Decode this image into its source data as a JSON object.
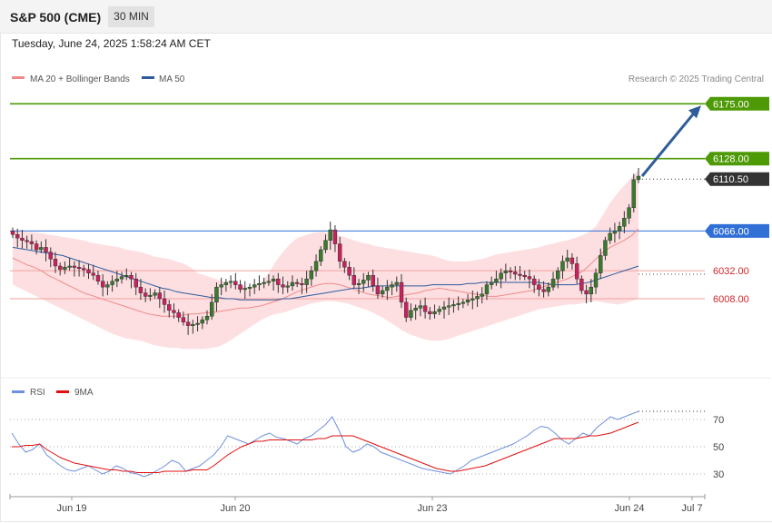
{
  "header": {
    "symbol_title": "S&P 500 (CME)",
    "timeframe_button": "30 MIN",
    "timestamp": "Tuesday, June 24, 2025 1:58:24 AM CET",
    "credit": "Research © 2025 Trading Central"
  },
  "colors": {
    "up_candle": "#3a7a2e",
    "down_candle": "#c7225f",
    "ma20": "#f08b8b",
    "ma50": "#2e5b9c",
    "band_fill": "#fdd7d9",
    "resistance": "#4e9a06",
    "support": "#f2a0a0",
    "current_price": "#333333",
    "pivot": "#2f6fd6",
    "rsi": "#6e90e0",
    "rsi_ma": "#e01010",
    "arrow": "#2f5d9a"
  },
  "chart_data": [
    {
      "type": "candlestick",
      "legend": [
        {
          "name": "MA 20 + Bollinger Bands",
          "color": "#f08b8b"
        },
        {
          "name": "MA 50",
          "color": "#2e5b9c"
        }
      ],
      "x_ticks": [
        "Jun 19",
        "Jun 20",
        "Jun 23",
        "Jun 24",
        "Jul 7"
      ],
      "ylim": [
        5945,
        6190
      ],
      "levels": [
        {
          "label": "6175.00",
          "value": 6175.0,
          "kind": "resistance"
        },
        {
          "label": "6128.00",
          "value": 6128.0,
          "kind": "resistance"
        },
        {
          "label": "6110.50",
          "value": 6110.5,
          "kind": "current"
        },
        {
          "label": "6066.00",
          "value": 6066.0,
          "kind": "pivot"
        },
        {
          "label": "6032.00",
          "value": 6032.0,
          "kind": "support"
        },
        {
          "label": "6008.00",
          "value": 6008.0,
          "kind": "support"
        }
      ],
      "close": [
        6063,
        6060,
        6058,
        6057,
        6055,
        6050,
        6052,
        6048,
        6042,
        6036,
        6033,
        6035,
        6036,
        6035,
        6034,
        6033,
        6030,
        6028,
        6023,
        6018,
        6020,
        6023,
        6025,
        6027,
        6028,
        6025,
        6018,
        6013,
        6010,
        6011,
        6013,
        6008,
        6003,
        5998,
        5996,
        5992,
        5988,
        5985,
        5986,
        5987,
        5990,
        5993,
        6005,
        6018,
        6020,
        6022,
        6023,
        6020,
        6016,
        6017,
        6018,
        6020,
        6021,
        6022,
        6023,
        6025,
        6020,
        6018,
        6019,
        6022,
        6021,
        6020,
        6025,
        6032,
        6040,
        6050,
        6058,
        6067,
        6055,
        6040,
        6035,
        6028,
        6020,
        6021,
        6024,
        6028,
        6019,
        6012,
        6015,
        6018,
        6020,
        6022,
        6005,
        5992,
        5998,
        6000,
        6002,
        5997,
        5995,
        5997,
        5999,
        6001,
        6002,
        6003,
        6004,
        6005,
        6007,
        6008,
        6010,
        6012,
        6020,
        6022,
        6025,
        6030,
        6032,
        6031,
        6029,
        6028,
        6027,
        6025,
        6020,
        6016,
        6014,
        6018,
        6025,
        6032,
        6040,
        6043,
        6038,
        6025,
        6015,
        6012,
        6018,
        6030,
        6045,
        6058,
        6064,
        6066,
        6070,
        6077,
        6086,
        6110,
        6113
      ],
      "ma20": [
        6043,
        6040,
        6037,
        6035,
        6032,
        6028,
        6025,
        6022,
        6019,
        6016,
        6013,
        6011,
        6009,
        6007,
        6005,
        6003,
        6001,
        5999,
        5997,
        5995,
        5994,
        5993,
        5993,
        5993,
        5994,
        5995,
        5995,
        5996,
        5996,
        5997,
        5998,
        5999,
        6000,
        6000,
        6001,
        6002,
        6004,
        6006,
        6008,
        6011,
        6014,
        6016,
        6018,
        6020,
        6021,
        6021,
        6020,
        6018,
        6016,
        6014,
        6012,
        6011,
        6010,
        6009,
        6010,
        6011,
        6012,
        6013,
        6015,
        6016,
        6017,
        6016,
        6015,
        6014,
        6013,
        6012,
        6011,
        6010,
        6010,
        6011,
        6012,
        6013,
        6014,
        6015,
        6017,
        6019,
        6021,
        6023,
        6025,
        6028,
        6031,
        6036,
        6042,
        6048,
        6052,
        6055,
        6058,
        6062,
        6068
      ],
      "bb_upper": [
        6066,
        6066,
        6065,
        6065,
        6064,
        6063,
        6062,
        6061,
        6060,
        6059,
        6058,
        6056,
        6055,
        6054,
        6053,
        6052,
        6050,
        6049,
        6048,
        6046,
        6044,
        6043,
        6042,
        6040,
        6038,
        6035,
        6030,
        6028,
        6026,
        6024,
        6022,
        6021,
        6020,
        6018,
        6018,
        6022,
        6030,
        6040,
        6048,
        6055,
        6060,
        6062,
        6064,
        6065,
        6065,
        6064,
        6062,
        6060,
        6058,
        6056,
        6055,
        6053,
        6052,
        6051,
        6050,
        6049,
        6048,
        6047,
        6046,
        6045,
        6043,
        6041,
        6040,
        6040,
        6040,
        6041,
        6042,
        6044,
        6046,
        6047,
        6048,
        6049,
        6050,
        6051,
        6052,
        6054,
        6055,
        6057,
        6058,
        6060,
        6062,
        6065,
        6070,
        6080,
        6090,
        6098,
        6105,
        6112,
        6118
      ],
      "bb_lower": [
        6020,
        6017,
        6014,
        6011,
        6008,
        6005,
        6002,
        5999,
        5996,
        5993,
        5990,
        5987,
        5984,
        5981,
        5978,
        5976,
        5974,
        5973,
        5972,
        5970,
        5968,
        5967,
        5966,
        5966,
        5965,
        5965,
        5965,
        5965,
        5966,
        5967,
        5970,
        5974,
        5978,
        5982,
        5986,
        5990,
        5993,
        5995,
        5996,
        5998,
        6000,
        6002,
        6004,
        6005,
        6006,
        6006,
        6005,
        6004,
        6002,
        6000,
        5998,
        5995,
        5992,
        5988,
        5984,
        5980,
        5977,
        5975,
        5973,
        5972,
        5972,
        5973,
        5975,
        5977,
        5979,
        5981,
        5983,
        5985,
        5987,
        5989,
        5991,
        5993,
        5995,
        5997,
        5999,
        6000,
        6001,
        6002,
        6003,
        6003,
        6004,
        6005,
        6006,
        6005,
        6004,
        6003,
        6004,
        6006,
        6008
      ],
      "ma50": [
        6052,
        6051,
        6050,
        6049,
        6048,
        6047,
        6046,
        6045,
        6043,
        6041,
        6039,
        6037,
        6035,
        6033,
        6031,
        6029,
        6027,
        6025,
        6023,
        6021,
        6019,
        6017,
        6016,
        6014,
        6013,
        6012,
        6011,
        6010,
        6009,
        6009,
        6008,
        6008,
        6007,
        6007,
        6007,
        6007,
        6007,
        6007,
        6008,
        6008,
        6009,
        6010,
        6011,
        6012,
        6013,
        6014,
        6015,
        6016,
        6017,
        6017,
        6018,
        6019,
        6019,
        6019,
        6019,
        6019,
        6019,
        6019,
        6019,
        6020,
        6020,
        6020,
        6020,
        6020,
        6021,
        6021,
        6022,
        6022,
        6022,
        6022,
        6022,
        6022,
        6022,
        6022,
        6022,
        6021,
        6020,
        6020,
        6020,
        6020,
        6021,
        6022,
        6024,
        6026,
        6028,
        6030,
        6032,
        6034,
        6036
      ]
    },
    {
      "type": "line",
      "legend": [
        {
          "name": "RSI",
          "color": "#6e90e0"
        },
        {
          "name": "9MA",
          "color": "#e01010"
        }
      ],
      "ylim": [
        20,
        80
      ],
      "y_ticks": [
        70,
        50,
        30
      ],
      "series": [
        {
          "name": "RSI",
          "values": [
            60,
            52,
            46,
            48,
            52,
            44,
            40,
            36,
            33,
            32,
            34,
            36,
            33,
            30,
            32,
            36,
            34,
            31,
            30,
            28,
            30,
            33,
            36,
            40,
            38,
            32,
            34,
            36,
            40,
            44,
            50,
            58,
            56,
            54,
            52,
            55,
            58,
            60,
            57,
            56,
            54,
            52,
            56,
            58,
            62,
            66,
            72,
            62,
            50,
            46,
            48,
            52,
            50,
            46,
            44,
            42,
            40,
            38,
            36,
            34,
            33,
            32,
            31,
            30,
            33,
            36,
            40,
            42,
            44,
            46,
            48,
            50,
            52,
            55,
            58,
            62,
            65,
            64,
            60,
            55,
            52,
            56,
            60,
            58,
            64,
            68,
            72,
            70,
            72,
            74,
            76
          ]
        },
        {
          "name": "9MA",
          "values": [
            50,
            50,
            51,
            51,
            52,
            48,
            45,
            42,
            40,
            38,
            37,
            36,
            35,
            34,
            33,
            33,
            32,
            32,
            31,
            31,
            31,
            31,
            32,
            32,
            32,
            32,
            33,
            33,
            33,
            36,
            40,
            44,
            47,
            50,
            52,
            54,
            54,
            55,
            55,
            55,
            55,
            55,
            55,
            55,
            56,
            56,
            58,
            58,
            58,
            58,
            56,
            54,
            52,
            50,
            48,
            46,
            44,
            42,
            40,
            38,
            36,
            34,
            33,
            32,
            32,
            33,
            34,
            35,
            36,
            38,
            40,
            42,
            44,
            46,
            48,
            50,
            52,
            54,
            56,
            56,
            56,
            56,
            57,
            58,
            58,
            59,
            60,
            62,
            64,
            66,
            68
          ]
        }
      ]
    }
  ]
}
